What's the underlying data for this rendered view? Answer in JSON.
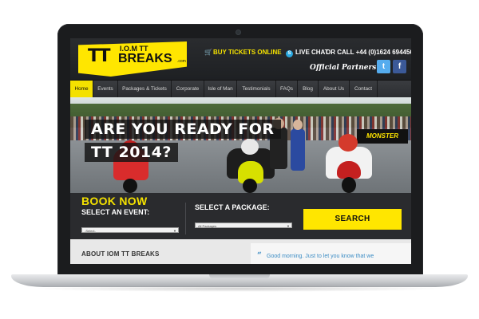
{
  "header": {
    "logo": {
      "tt": "TT",
      "iom": "I.O.M TT",
      "breaks": "BREAKS",
      "tld": ".com"
    },
    "buy_tickets": "BUY TICKETS ONLINE",
    "live_chat": "LIVE CHAT",
    "call": "OR CALL +44 (0)1624 694456",
    "partners": "Official Partners",
    "twitter": "t",
    "facebook": "f"
  },
  "nav": {
    "items": [
      {
        "label": "Home"
      },
      {
        "label": "Events"
      },
      {
        "label": "Packages & Tickets"
      },
      {
        "label": "Corporate"
      },
      {
        "label": "Isle of Man"
      },
      {
        "label": "Testimonials"
      },
      {
        "label": "FAQs"
      },
      {
        "label": "Blog"
      },
      {
        "label": "About Us"
      },
      {
        "label": "Contact"
      }
    ],
    "active_index": 0
  },
  "hero": {
    "line1": "ARE YOU READY FOR",
    "line2": "TT 2014?",
    "banner": "MONSTER"
  },
  "booking": {
    "title": "BOOK NOW",
    "event_label": "SELECT AN EVENT:",
    "event_value": "-Select-",
    "package_label": "SELECT A PACKAGE:",
    "package_value": "All Packages",
    "search_label": "SEARCH"
  },
  "lower": {
    "about_title": "ABOUT IOM TT BREAKS",
    "quote_mark": "“",
    "testimonial": "Good morning. Just to let you know that we"
  },
  "colors": {
    "accent": "#f4e100",
    "header_bg": "#2a2c2f",
    "chat_blue": "#2aa8e0",
    "twitter": "#55acee",
    "facebook": "#3b5998",
    "testimonial_blue": "#3b8cc4"
  }
}
